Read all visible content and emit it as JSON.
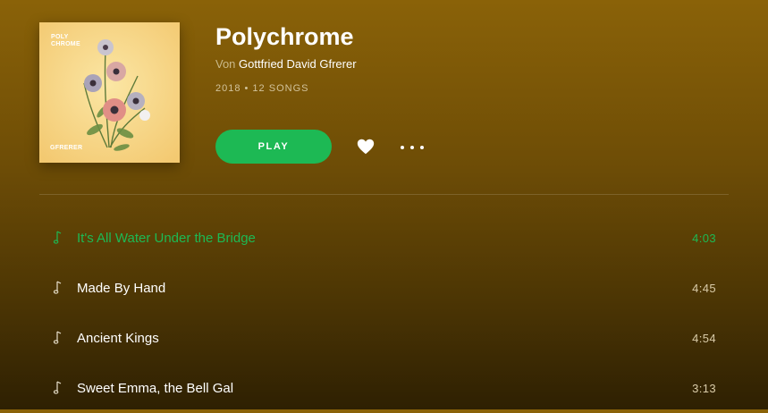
{
  "album": {
    "cover": {
      "title_line1": "POLY",
      "title_line2": "CHROME",
      "artist_text": "GFRERER"
    },
    "title": "Polychrome",
    "by_label": "Von",
    "artist": "Gottfried David Gfrerer",
    "meta": "2018 • 12 SONGS"
  },
  "controls": {
    "play_label": "PLAY",
    "heart_icon": "heart-icon",
    "more_icon": "more-icon"
  },
  "tracks": [
    {
      "name": "It's All Water Under the Bridge",
      "duration": "4:03",
      "active": true
    },
    {
      "name": "Made By Hand",
      "duration": "4:45",
      "active": false
    },
    {
      "name": "Ancient Kings",
      "duration": "4:54",
      "active": false
    },
    {
      "name": "Sweet Emma, the Bell Gal",
      "duration": "3:13",
      "active": false
    }
  ],
  "colors": {
    "accent": "#1db954",
    "bg_top": "#8a6208",
    "bg_bottom": "#2e2002"
  }
}
